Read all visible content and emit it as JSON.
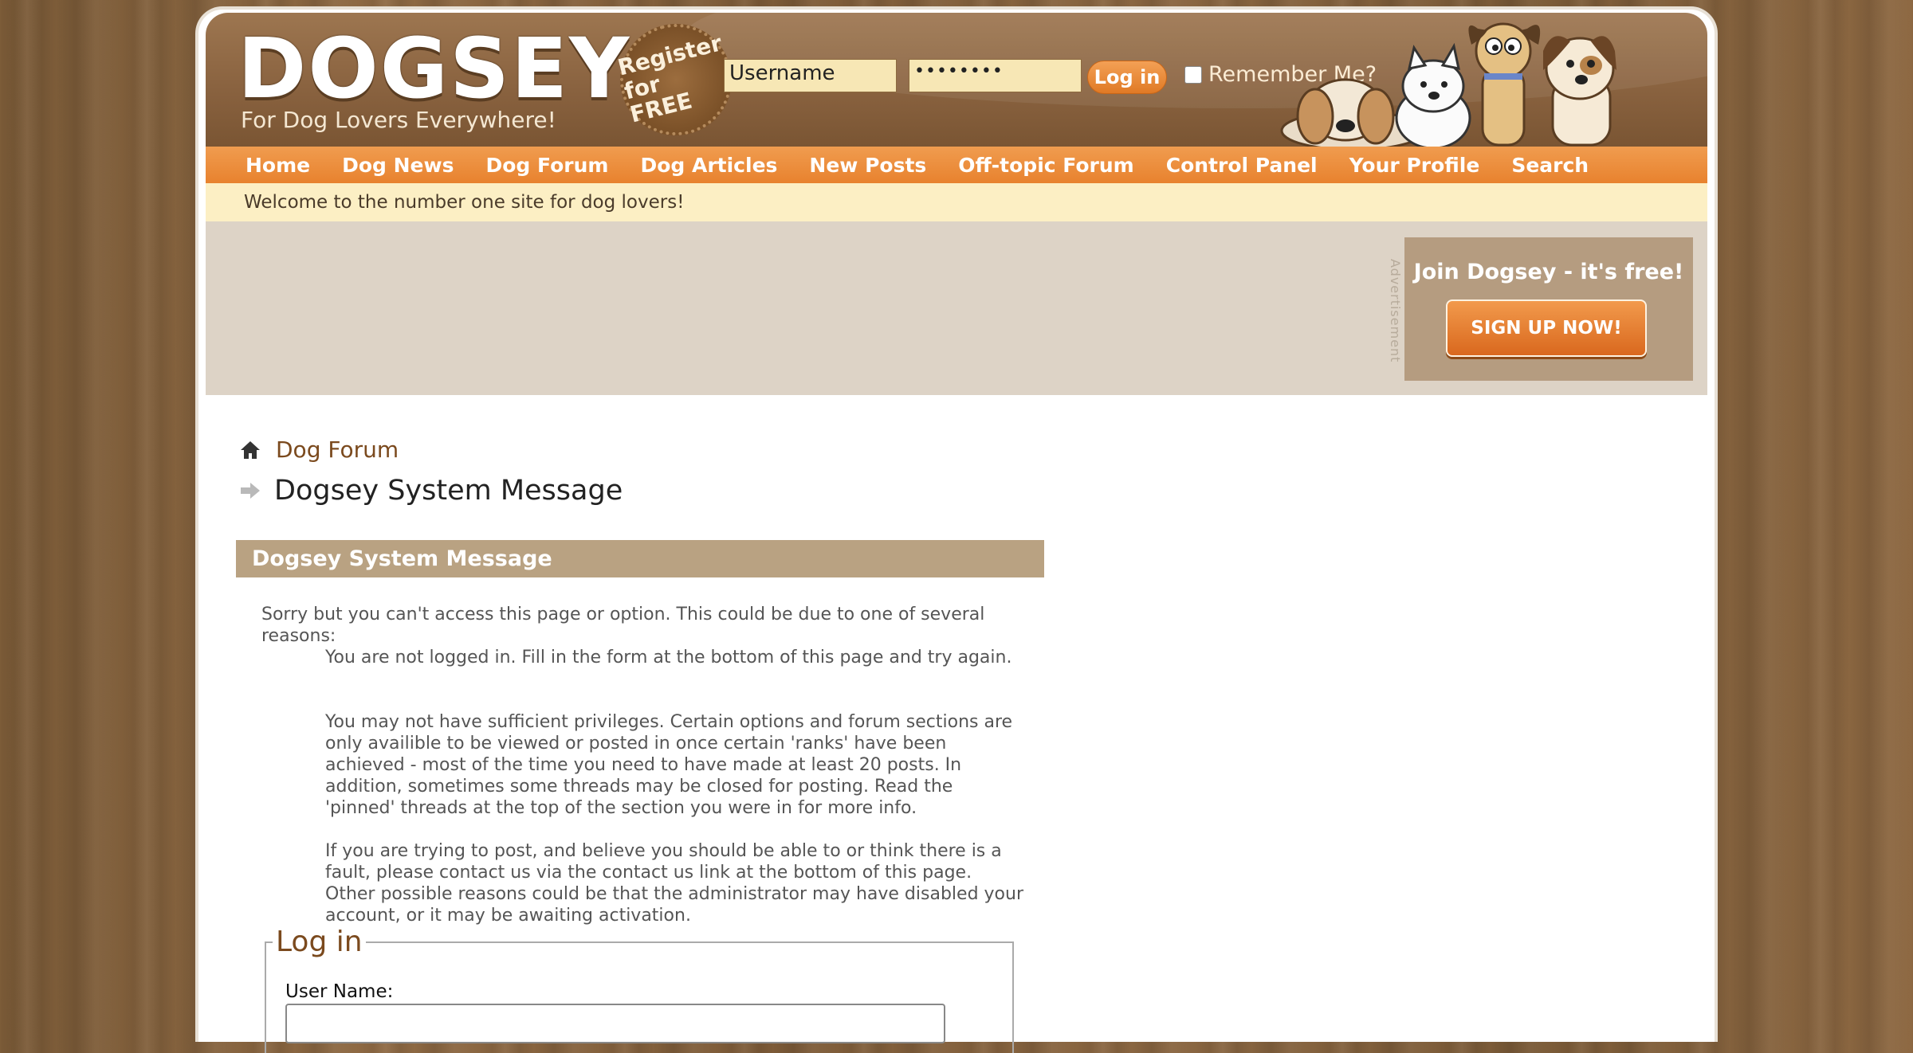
{
  "header": {
    "logo": "DOGSEY",
    "tagline": "For Dog Lovers Everywhere!",
    "badge_line1": "Register",
    "badge_line2": "for FREE",
    "username_value": "Username",
    "password_value": "••••••••",
    "login_button": "Log in",
    "remember_label": "Remember Me?"
  },
  "nav": {
    "items": [
      "Home",
      "Dog News",
      "Dog Forum",
      "Dog Articles",
      "New Posts",
      "Off-topic Forum",
      "Control Panel",
      "Your Profile",
      "Search"
    ]
  },
  "welcome": "Welcome to the number one site for dog lovers!",
  "ad": {
    "label": "Advertisement",
    "join_text": "Join Dogsey - it's free!",
    "signup_button": "SIGN UP NOW!"
  },
  "breadcrumb": {
    "parent": "Dog Forum",
    "current": "Dogsey System Message"
  },
  "panel": {
    "title": "Dogsey System Message",
    "intro": "Sorry but you can't access this page or option. This could be due to one of several reasons:",
    "reasons": [
      "You are not logged in. Fill in the form at the bottom of this page and try again.",
      "You may not have sufficient privileges. Certain options and forum sections are only availible to be viewed or posted in once certain 'ranks' have been achieved - most of the time you need to have made at least 20 posts. In addition, sometimes some threads may be closed for posting. Read the 'pinned' threads at the top of the section you were in for more info.",
      "If you are trying to post, and believe you should be able to or think there is a fault, please contact us via the contact us link at the bottom of this page. Other possible reasons could be that the administrator may have disabled your account, or it may be awaiting activation."
    ]
  },
  "login_form": {
    "legend": "Log in",
    "username_label": "User Name:",
    "username_value": ""
  },
  "colors": {
    "nav_orange": "#e8822e",
    "header_brown": "#8a6340",
    "panel_tan": "#b9a282",
    "link_brown": "#7b4a1e"
  }
}
